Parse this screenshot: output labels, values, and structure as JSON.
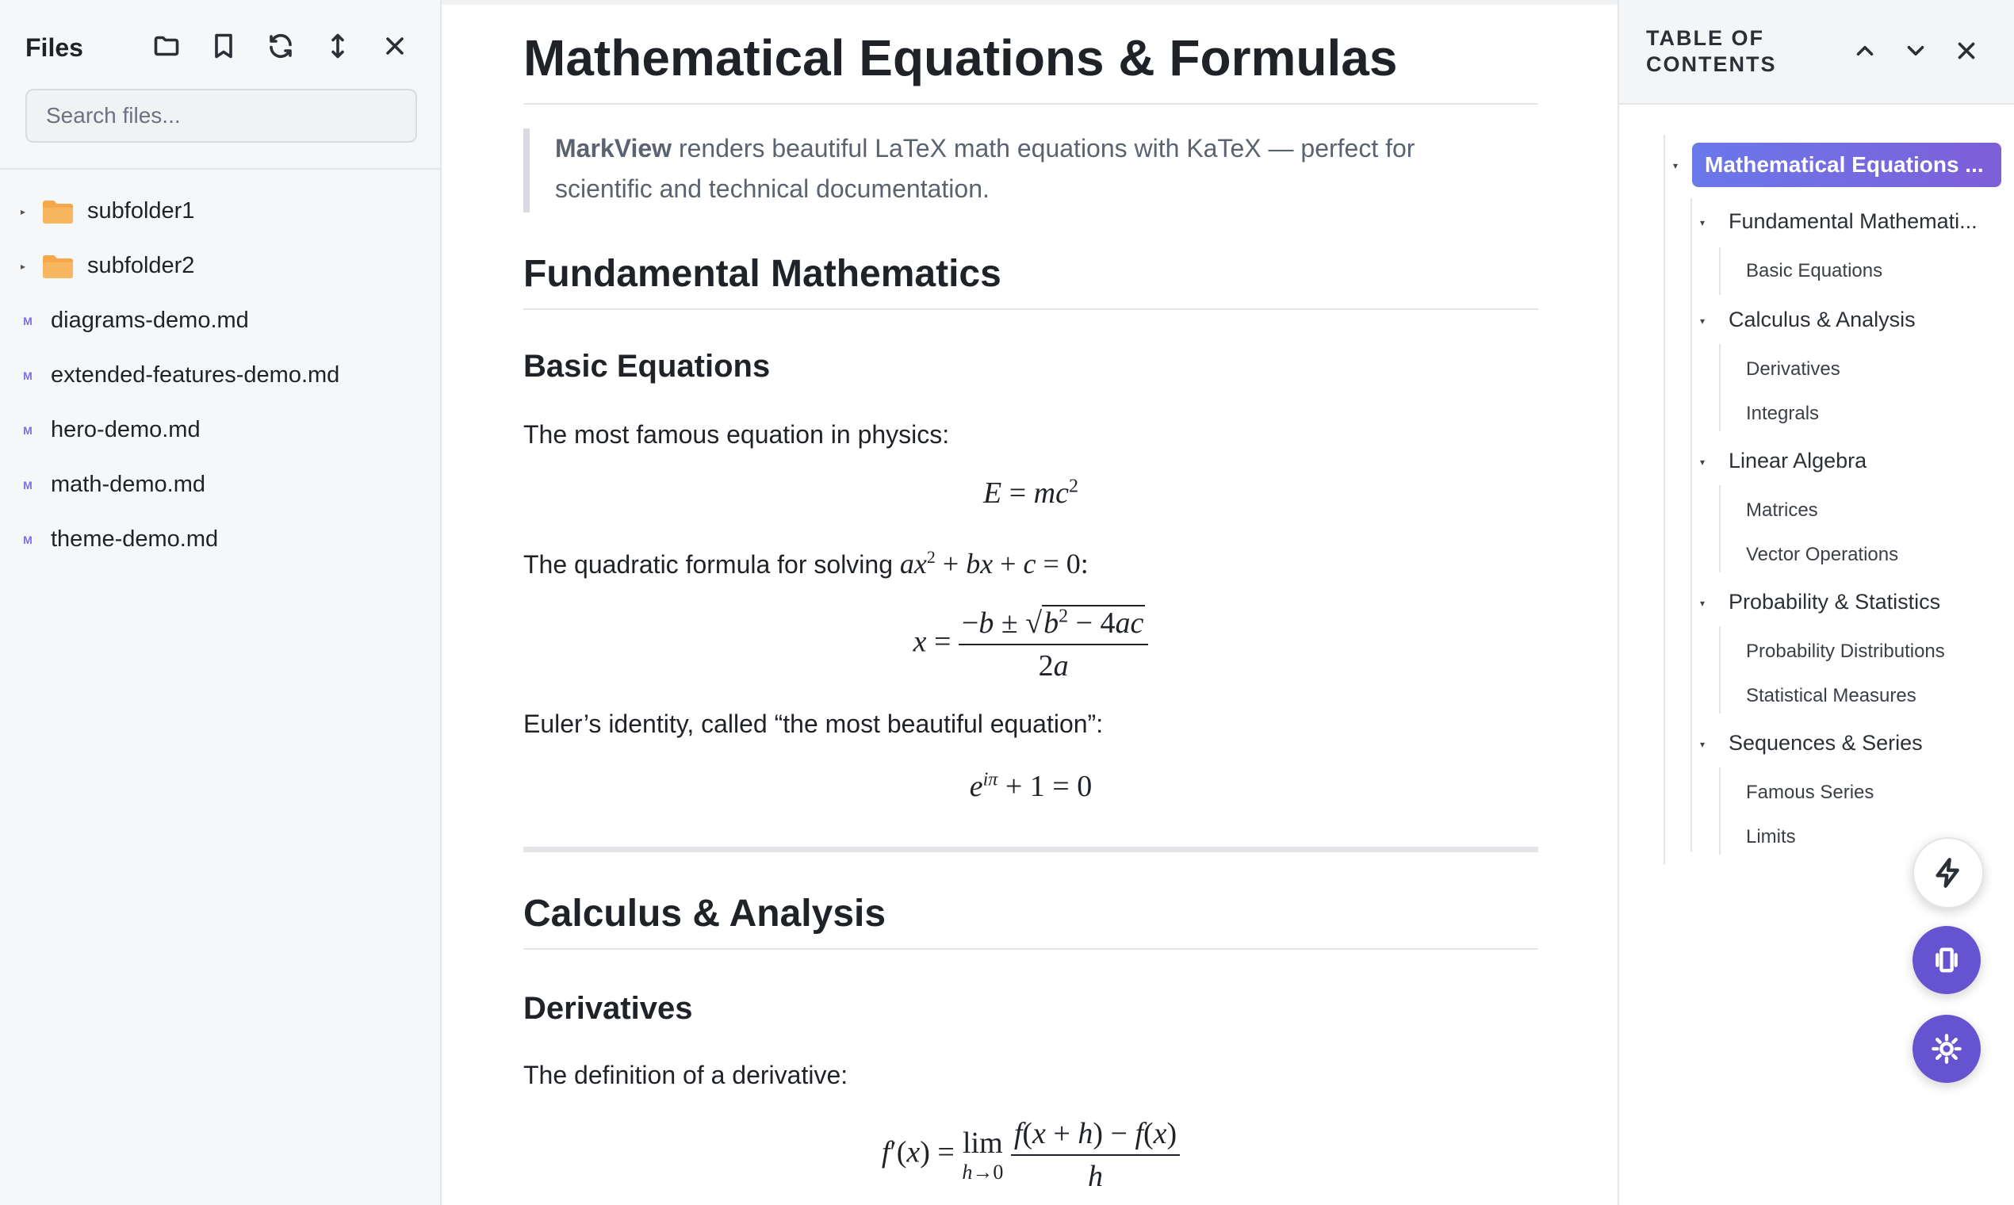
{
  "sidebar": {
    "title": "Files",
    "search_placeholder": "Search files...",
    "folders": [
      "subfolder1",
      "subfolder2"
    ],
    "files": [
      "diagrams-demo.md",
      "extended-features-demo.md",
      "hero-demo.md",
      "math-demo.md",
      "theme-demo.md"
    ],
    "file_badge": "M"
  },
  "doc": {
    "title": "Mathematical Equations & Formulas",
    "intro_bold": "MarkView",
    "intro_line1": " renders beautiful LaTeX math equations with KaTeX — perfect for",
    "intro_line2": "scientific and technical documentation.",
    "h2_fundamental": "Fundamental Mathematics",
    "h3_basic": "Basic Equations",
    "p_famous": "The most famous equation in physics:",
    "p_quadratic": "The quadratic formula for solving",
    "p_euler": "Euler’s identity, called “the most beautiful equation”:",
    "h2_calculus": "Calculus & Analysis",
    "h3_derivatives": "Derivatives",
    "p_derivative": "The definition of a derivative:"
  },
  "toc": {
    "title_line1": "TABLE OF",
    "title_line2": "CONTENTS",
    "active": "Mathematical Equations ...",
    "sections": [
      {
        "label": "Fundamental Mathemati...",
        "children": [
          "Basic Equations"
        ]
      },
      {
        "label": "Calculus & Analysis",
        "children": [
          "Derivatives",
          "Integrals"
        ]
      },
      {
        "label": "Linear Algebra",
        "children": [
          "Matrices",
          "Vector Operations"
        ]
      },
      {
        "label": "Probability & Statistics",
        "children": [
          "Probability Distributions",
          "Statistical Measures"
        ]
      },
      {
        "label": "Sequences & Series",
        "children": [
          "Famous Series",
          "Limits"
        ]
      }
    ]
  }
}
